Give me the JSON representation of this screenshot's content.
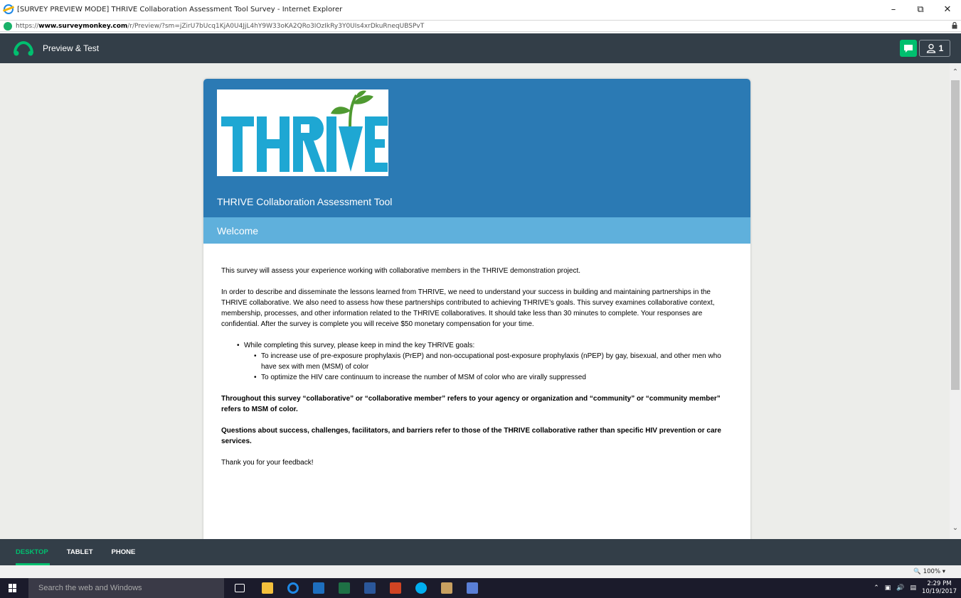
{
  "window": {
    "title": "[SURVEY PREVIEW MODE] THRIVE Collaboration Assessment Tool Survey - Internet Explorer",
    "minimize": "–",
    "restore": "⧉",
    "close": "✕"
  },
  "address": {
    "scheme": "https://",
    "host": "www.surveymonkey.com",
    "path": "/r/Preview/?sm=jZirU7bUcq1KjA0U4JjL4hY9W33oKA2QRo3IOzIkRy3Y0UIs4xrDkuRneqUBSPvT"
  },
  "header": {
    "preview_label": "Preview & Test",
    "user_count": "1"
  },
  "survey": {
    "logo_text": "THRIVE",
    "title": "THRIVE Collaboration Assessment Tool",
    "page_title": "Welcome",
    "intro": "This survey will assess your experience working with collaborative members in the THRIVE demonstration project.",
    "paragraph": "In order to describe and disseminate the lessons learned from THRIVE, we need to understand your success in building and maintaining partnerships in the THRIVE collaborative. We also need to assess how these partnerships contributed to achieving THRIVE’s goals. This survey examines collaborative context, membership, processes, and other information related to the THRIVE collaboratives. It should take less than 30 minutes to complete. Your responses are confidential.  After the survey is complete you will receive $50 monetary compensation for your time.",
    "bullet_main": "While completing this survey, please keep in mind the key THRIVE goals:",
    "bullet_sub1": "To increase use of pre-exposure prophylaxis (PrEP) and non-occupational post-exposure prophylaxis (nPEP) by gay, bisexual, and other men who have sex with men (MSM) of color",
    "bullet_sub2": "To optimize the HIV care continuum to increase the number of MSM of color who are virally suppressed",
    "bold1": "Throughout this survey “collaborative” or “collaborative member” refers to your agency or organization and “community” or “community member” refers to MSM of color.",
    "bold2": "Questions about success, challenges, facilitators, and barriers refer to those of the THRIVE collaborative rather than specific HIV prevention or care services.",
    "thanks": "Thank you for your feedback!"
  },
  "devices": {
    "desktop": "DESKTOP",
    "tablet": "TABLET",
    "phone": "PHONE"
  },
  "status": {
    "zoom": "100%"
  },
  "taskbar": {
    "search_placeholder": "Search the web and Windows",
    "time": "2:29 PM",
    "date": "10/19/2017"
  },
  "colors": {
    "header_dark": "#333e48",
    "survey_blue": "#2b7ab4",
    "welcome_blue": "#5fb0dc",
    "thrive_cyan": "#1ea7d3",
    "thrive_green": "#4f9a31",
    "accent_green": "#00bf6f"
  }
}
